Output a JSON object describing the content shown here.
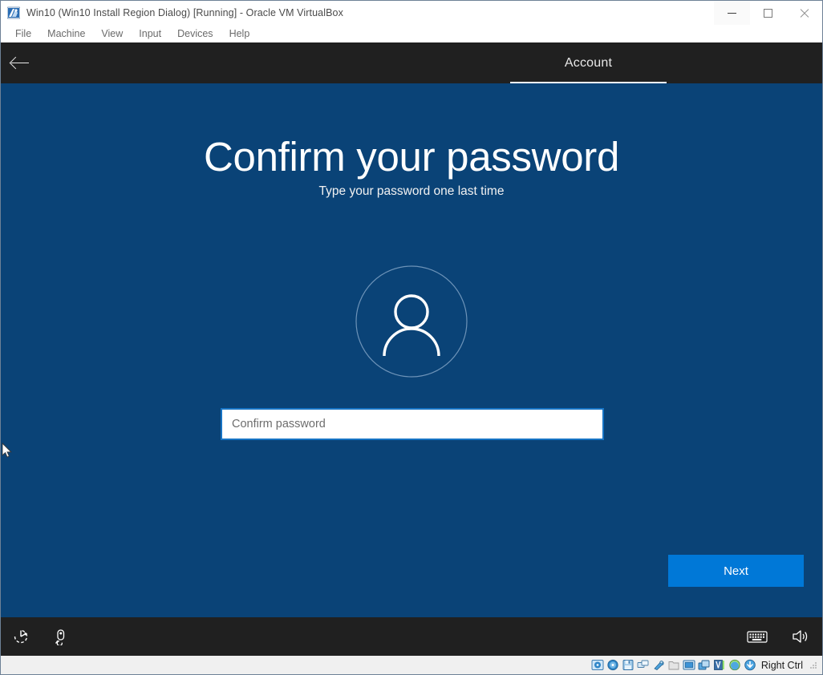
{
  "host_window": {
    "title": "Win10 (Win10 Install Region Dialog) [Running] - Oracle VM VirtualBox",
    "app_icon": "virtualbox-icon",
    "controls": {
      "minimize": "minimize-icon",
      "maximize": "maximize-icon",
      "close": "close-icon"
    },
    "menu": [
      {
        "label": "File"
      },
      {
        "label": "Machine"
      },
      {
        "label": "View"
      },
      {
        "label": "Input"
      },
      {
        "label": "Devices"
      },
      {
        "label": "Help"
      }
    ]
  },
  "guest": {
    "header": {
      "back_icon": "back-arrow-icon",
      "tab_label": "Account"
    },
    "content": {
      "heading": "Confirm your password",
      "subtitle": "Type your password one last time",
      "avatar_icon": "user-avatar-icon",
      "password_field": {
        "value": "",
        "placeholder": "Confirm password"
      },
      "next_button": "Next"
    },
    "footer": {
      "left_icons": [
        {
          "name": "power-accessibility-icon"
        },
        {
          "name": "ease-of-access-icon"
        }
      ],
      "right_icons": [
        {
          "name": "keyboard-icon"
        },
        {
          "name": "volume-icon"
        }
      ]
    }
  },
  "status_bar": {
    "icons": [
      {
        "name": "hard-disk-icon"
      },
      {
        "name": "optical-disk-icon"
      },
      {
        "name": "floppy-disk-icon"
      },
      {
        "name": "network-icon"
      },
      {
        "name": "usb-icon"
      },
      {
        "name": "shared-folders-icon"
      },
      {
        "name": "display-icon"
      },
      {
        "name": "recording-icon"
      },
      {
        "name": "virtualbox-guest-additions-icon"
      },
      {
        "name": "mouse-integration-icon"
      },
      {
        "name": "host-key-icon"
      }
    ],
    "host_key": "Right Ctrl"
  },
  "colors": {
    "guest_background": "#0a4377",
    "oobe_bar": "#202020",
    "accent_button": "#0078d7",
    "input_border": "#1673c4"
  }
}
